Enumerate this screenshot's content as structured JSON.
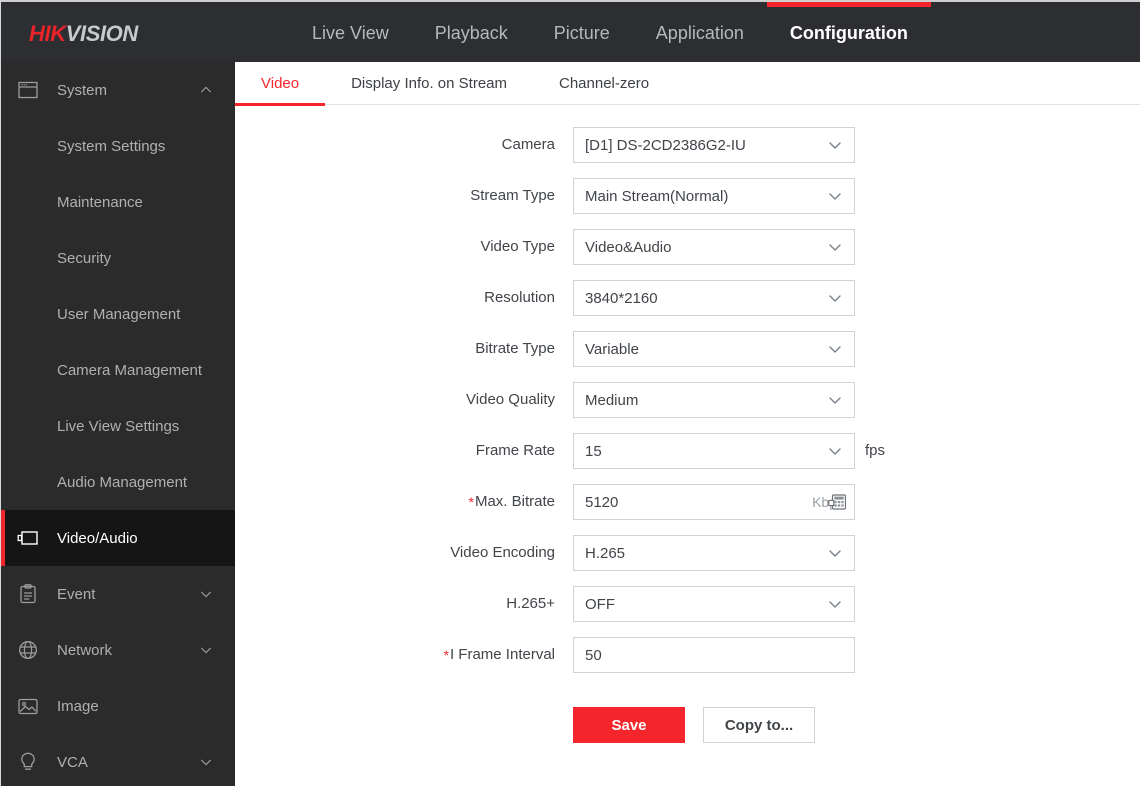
{
  "header": {
    "logo_hik": "HIK",
    "logo_vision": "VISION",
    "nav": [
      {
        "label": "Live View",
        "active": false
      },
      {
        "label": "Playback",
        "active": false
      },
      {
        "label": "Picture",
        "active": false
      },
      {
        "label": "Application",
        "active": false
      },
      {
        "label": "Configuration",
        "active": true
      }
    ],
    "accent_color": "#f5262b",
    "background_color": "#2c2e32"
  },
  "sidebar": {
    "background_color": "#2b2b2b",
    "items": [
      {
        "label": "System",
        "icon": "system-window-icon",
        "chevron": "chevron-up-icon",
        "level": "top",
        "active": false
      },
      {
        "label": "System Settings",
        "icon": "",
        "chevron": "",
        "level": "sub",
        "active": false
      },
      {
        "label": "Maintenance",
        "icon": "",
        "chevron": "",
        "level": "sub",
        "active": false
      },
      {
        "label": "Security",
        "icon": "",
        "chevron": "",
        "level": "sub",
        "active": false
      },
      {
        "label": "User Management",
        "icon": "",
        "chevron": "",
        "level": "sub",
        "active": false
      },
      {
        "label": "Camera Management",
        "icon": "",
        "chevron": "",
        "level": "sub",
        "active": false
      },
      {
        "label": "Live View Settings",
        "icon": "",
        "chevron": "",
        "level": "sub",
        "active": false
      },
      {
        "label": "Audio Management",
        "icon": "",
        "chevron": "",
        "level": "sub",
        "active": false
      },
      {
        "label": "Video/Audio",
        "icon": "video-camera-icon",
        "chevron": "",
        "level": "top",
        "active": true
      },
      {
        "label": "Event",
        "icon": "clipboard-icon",
        "chevron": "chevron-down-icon",
        "level": "top",
        "active": false
      },
      {
        "label": "Network",
        "icon": "globe-icon",
        "chevron": "chevron-down-icon",
        "level": "top",
        "active": false
      },
      {
        "label": "Image",
        "icon": "picture-icon",
        "chevron": "",
        "level": "top",
        "active": false
      },
      {
        "label": "VCA",
        "icon": "lightbulb-icon",
        "chevron": "chevron-down-icon",
        "level": "top",
        "active": false
      }
    ]
  },
  "main": {
    "tabs": [
      {
        "label": "Video",
        "active": true
      },
      {
        "label": "Display Info. on Stream",
        "active": false
      },
      {
        "label": "Channel-zero",
        "active": false
      }
    ],
    "fields": [
      {
        "label": "Camera",
        "required": false,
        "value": "[D1] DS-2CD2386G2-IU",
        "control": "select",
        "suffix_inside": "",
        "suffix_outside": "",
        "unit_icon": ""
      },
      {
        "label": "Stream Type",
        "required": false,
        "value": "Main Stream(Normal)",
        "control": "select",
        "suffix_inside": "",
        "suffix_outside": "",
        "unit_icon": ""
      },
      {
        "label": "Video Type",
        "required": false,
        "value": "Video&Audio",
        "control": "select",
        "suffix_inside": "",
        "suffix_outside": "",
        "unit_icon": ""
      },
      {
        "label": "Resolution",
        "required": false,
        "value": "3840*2160",
        "control": "select",
        "suffix_inside": "",
        "suffix_outside": "",
        "unit_icon": ""
      },
      {
        "label": "Bitrate Type",
        "required": false,
        "value": "Variable",
        "control": "select",
        "suffix_inside": "",
        "suffix_outside": "",
        "unit_icon": ""
      },
      {
        "label": "Video Quality",
        "required": false,
        "value": "Medium",
        "control": "select",
        "suffix_inside": "",
        "suffix_outside": "",
        "unit_icon": ""
      },
      {
        "label": "Frame Rate",
        "required": false,
        "value": "15",
        "control": "select",
        "suffix_inside": "",
        "suffix_outside": "fps",
        "unit_icon": ""
      },
      {
        "label": "Max. Bitrate",
        "required": true,
        "value": "5120",
        "control": "input",
        "suffix_inside": "Kbps",
        "suffix_outside": "",
        "unit_icon": "keypad-icon"
      },
      {
        "label": "Video Encoding",
        "required": false,
        "value": "H.265",
        "control": "select",
        "suffix_inside": "",
        "suffix_outside": "",
        "unit_icon": ""
      },
      {
        "label": "H.265+",
        "required": false,
        "value": "OFF",
        "control": "select",
        "suffix_inside": "",
        "suffix_outside": "",
        "unit_icon": ""
      },
      {
        "label": "I Frame Interval",
        "required": true,
        "value": "50",
        "control": "input",
        "suffix_inside": "",
        "suffix_outside": "",
        "unit_icon": ""
      }
    ],
    "buttons": {
      "save_label": "Save",
      "copy_label": "Copy to..."
    },
    "required_marker": "*"
  }
}
